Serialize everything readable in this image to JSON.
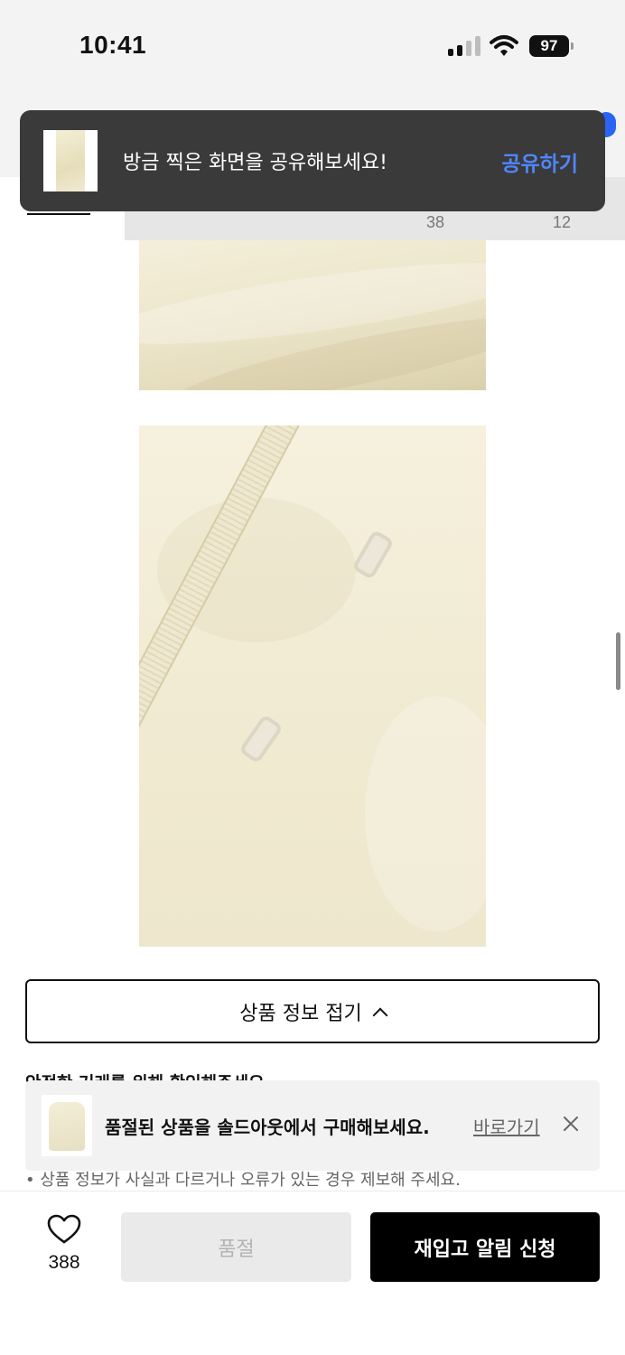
{
  "status_bar": {
    "time": "10:41",
    "battery": "97"
  },
  "tabs": {
    "count_1": "38",
    "count_2": "12"
  },
  "toast": {
    "message": "방금 찍은 화면을 공유해보세요!",
    "action": "공유하기",
    "action_color": "#4f86ff"
  },
  "product_info": {
    "collapse_label": "상품 정보 접기",
    "safe_trade_title": "안전한 거래를 위해 확인해주세요",
    "notice": "• 상품 정보가 사실과 다르거나 오류가 있는 경우 제보해 주세요."
  },
  "soldout_banner": {
    "message": "품절된 상품을 솔드아웃에서 구매해보세요.",
    "link": "바로가기"
  },
  "bottom_bar": {
    "like_count": "388",
    "soldout_label": "품절",
    "restock_label": "재입고 알림 신청"
  },
  "icons": [
    "signal-icon",
    "wifi-icon",
    "battery-icon",
    "chevron-up-icon",
    "close-icon",
    "heart-icon"
  ]
}
